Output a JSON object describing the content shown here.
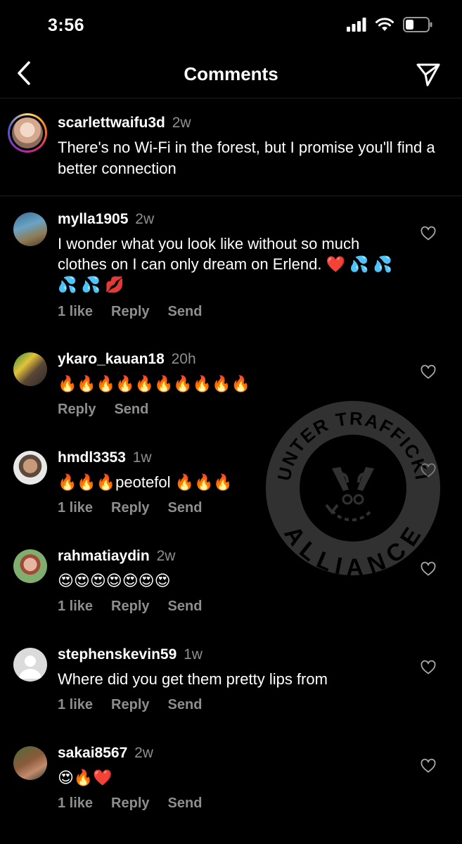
{
  "status": {
    "time": "3:56"
  },
  "header": {
    "title": "Comments"
  },
  "caption": {
    "username": "scarlettwaifu3d",
    "time": "2w",
    "text": "There's no Wi-Fi in the forest, but I promise you'll find a better connection"
  },
  "comments": [
    {
      "username": "mylla1905",
      "time": "2w",
      "text": "I wonder what you look like without so much clothes on I can only dream on Erlend. ❤️ 💦 💦 💦 💦 💋",
      "likes": "1 like",
      "reply": "Reply",
      "send": "Send"
    },
    {
      "username": "ykaro_kauan18",
      "time": "20h",
      "text": "🔥🔥🔥🔥🔥🔥🔥🔥🔥🔥",
      "reply": "Reply",
      "send": "Send"
    },
    {
      "username": "hmdl3353",
      "time": "1w",
      "text": "🔥🔥🔥peotefol 🔥🔥🔥",
      "likes": "1 like",
      "reply": "Reply",
      "send": "Send"
    },
    {
      "username": "rahmatiaydin",
      "time": "2w",
      "text": "😍😍😍😍😍😍😍",
      "likes": "1 like",
      "reply": "Reply",
      "send": "Send"
    },
    {
      "username": "stephenskevin59",
      "time": "1w",
      "text": "Where did you get them pretty lips from",
      "likes": "1 like",
      "reply": "Reply",
      "send": "Send"
    },
    {
      "username": "sakai8567",
      "time": "2w",
      "text": "😍🔥❤️",
      "likes": "1 like",
      "reply": "Reply",
      "send": "Send"
    }
  ],
  "watermark": {
    "top_text": "COUNTER TRAFFICKING",
    "bottom_text": "ALLIANCE"
  },
  "colors": {
    "background": "#000000",
    "secondary_text": "#8e8e8e",
    "divider": "#1f1f1f"
  }
}
